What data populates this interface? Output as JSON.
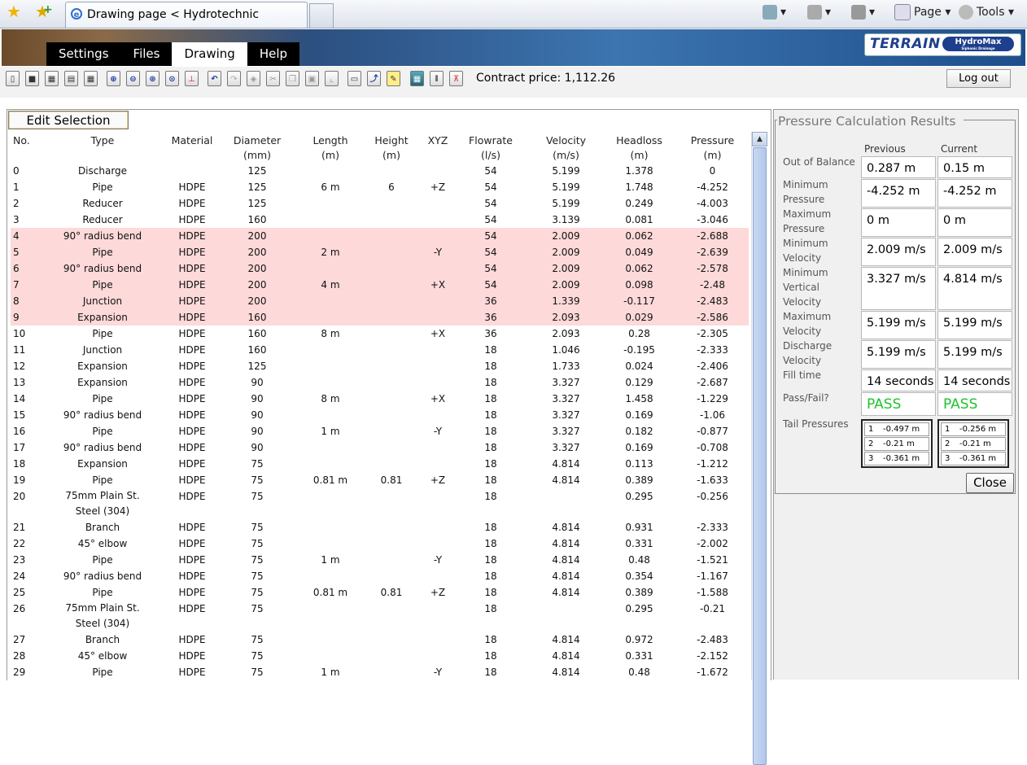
{
  "browser": {
    "tab_title": "Drawing page < Hydrotechnic",
    "page_label": "Page ▾",
    "tools_label": "Tools ▾"
  },
  "app": {
    "menu": [
      "Settings",
      "Files",
      "Drawing",
      "Help"
    ],
    "active_menu": "Drawing",
    "logo_text": "TERRAIN",
    "logo_product": "HydroMax",
    "logo_tagline": "Siphonic Drainage",
    "contract_price": "Contract price: 1,112.26",
    "logout_label": "Log out",
    "edit_selection_label": "Edit Selection"
  },
  "table": {
    "headers": {
      "no": "No.",
      "type": "Type",
      "material": "Material",
      "diameter": "Diameter\n(mm)",
      "length": "Length\n(m)",
      "height": "Height\n(m)",
      "xyz": "XYZ",
      "flowrate": "Flowrate\n(l/s)",
      "velocity": "Velocity\n(m/s)",
      "headloss": "Headloss\n(m)",
      "pressure": "Pressure\n(m)"
    },
    "rows": [
      {
        "no": "0",
        "type": "Discharge",
        "material": "",
        "diameter": "125",
        "length": "",
        "height": "",
        "xyz": "",
        "flowrate": "54",
        "velocity": "5.199",
        "headloss": "1.378",
        "pressure": "0",
        "hl": false
      },
      {
        "no": "1",
        "type": "Pipe",
        "material": "HDPE",
        "diameter": "125",
        "length": "6 m",
        "height": "6",
        "xyz": "+Z",
        "flowrate": "54",
        "velocity": "5.199",
        "headloss": "1.748",
        "pressure": "-4.252",
        "hl": false
      },
      {
        "no": "2",
        "type": "Reducer",
        "material": "HDPE",
        "diameter": "125",
        "length": "",
        "height": "",
        "xyz": "",
        "flowrate": "54",
        "velocity": "5.199",
        "headloss": "0.249",
        "pressure": "-4.003",
        "hl": false
      },
      {
        "no": "3",
        "type": "Reducer",
        "material": "HDPE",
        "diameter": "160",
        "length": "",
        "height": "",
        "xyz": "",
        "flowrate": "54",
        "velocity": "3.139",
        "headloss": "0.081",
        "pressure": "-3.046",
        "hl": false
      },
      {
        "no": "4",
        "type": "90° radius bend",
        "material": "HDPE",
        "diameter": "200",
        "length": "",
        "height": "",
        "xyz": "",
        "flowrate": "54",
        "velocity": "2.009",
        "headloss": "0.062",
        "pressure": "-2.688",
        "hl": true
      },
      {
        "no": "5",
        "type": "Pipe",
        "material": "HDPE",
        "diameter": "200",
        "length": "2 m",
        "height": "",
        "xyz": "-Y",
        "flowrate": "54",
        "velocity": "2.009",
        "headloss": "0.049",
        "pressure": "-2.639",
        "hl": true
      },
      {
        "no": "6",
        "type": "90° radius bend",
        "material": "HDPE",
        "diameter": "200",
        "length": "",
        "height": "",
        "xyz": "",
        "flowrate": "54",
        "velocity": "2.009",
        "headloss": "0.062",
        "pressure": "-2.578",
        "hl": true
      },
      {
        "no": "7",
        "type": "Pipe",
        "material": "HDPE",
        "diameter": "200",
        "length": "4 m",
        "height": "",
        "xyz": "+X",
        "flowrate": "54",
        "velocity": "2.009",
        "headloss": "0.098",
        "pressure": "-2.48",
        "hl": true
      },
      {
        "no": "8",
        "type": "Junction",
        "material": "HDPE",
        "diameter": "200",
        "length": "",
        "height": "",
        "xyz": "",
        "flowrate": "36",
        "velocity": "1.339",
        "headloss": "-0.117",
        "pressure": "-2.483",
        "hl": true
      },
      {
        "no": "9",
        "type": "Expansion",
        "material": "HDPE",
        "diameter": "160",
        "length": "",
        "height": "",
        "xyz": "",
        "flowrate": "36",
        "velocity": "2.093",
        "headloss": "0.029",
        "pressure": "-2.586",
        "hl": true
      },
      {
        "no": "10",
        "type": "Pipe",
        "material": "HDPE",
        "diameter": "160",
        "length": "8 m",
        "height": "",
        "xyz": "+X",
        "flowrate": "36",
        "velocity": "2.093",
        "headloss": "0.28",
        "pressure": "-2.305",
        "hl": false
      },
      {
        "no": "11",
        "type": "Junction",
        "material": "HDPE",
        "diameter": "160",
        "length": "",
        "height": "",
        "xyz": "",
        "flowrate": "18",
        "velocity": "1.046",
        "headloss": "-0.195",
        "pressure": "-2.333",
        "hl": false
      },
      {
        "no": "12",
        "type": "Expansion",
        "material": "HDPE",
        "diameter": "125",
        "length": "",
        "height": "",
        "xyz": "",
        "flowrate": "18",
        "velocity": "1.733",
        "headloss": "0.024",
        "pressure": "-2.406",
        "hl": false
      },
      {
        "no": "13",
        "type": "Expansion",
        "material": "HDPE",
        "diameter": "90",
        "length": "",
        "height": "",
        "xyz": "",
        "flowrate": "18",
        "velocity": "3.327",
        "headloss": "0.129",
        "pressure": "-2.687",
        "hl": false
      },
      {
        "no": "14",
        "type": "Pipe",
        "material": "HDPE",
        "diameter": "90",
        "length": "8 m",
        "height": "",
        "xyz": "+X",
        "flowrate": "18",
        "velocity": "3.327",
        "headloss": "1.458",
        "pressure": "-1.229",
        "hl": false
      },
      {
        "no": "15",
        "type": "90° radius bend",
        "material": "HDPE",
        "diameter": "90",
        "length": "",
        "height": "",
        "xyz": "",
        "flowrate": "18",
        "velocity": "3.327",
        "headloss": "0.169",
        "pressure": "-1.06",
        "hl": false
      },
      {
        "no": "16",
        "type": "Pipe",
        "material": "HDPE",
        "diameter": "90",
        "length": "1 m",
        "height": "",
        "xyz": "-Y",
        "flowrate": "18",
        "velocity": "3.327",
        "headloss": "0.182",
        "pressure": "-0.877",
        "hl": false
      },
      {
        "no": "17",
        "type": "90° radius bend",
        "material": "HDPE",
        "diameter": "90",
        "length": "",
        "height": "",
        "xyz": "",
        "flowrate": "18",
        "velocity": "3.327",
        "headloss": "0.169",
        "pressure": "-0.708",
        "hl": false
      },
      {
        "no": "18",
        "type": "Expansion",
        "material": "HDPE",
        "diameter": "75",
        "length": "",
        "height": "",
        "xyz": "",
        "flowrate": "18",
        "velocity": "4.814",
        "headloss": "0.113",
        "pressure": "-1.212",
        "hl": false
      },
      {
        "no": "19",
        "type": "Pipe",
        "material": "HDPE",
        "diameter": "75",
        "length": "0.81 m",
        "height": "0.81",
        "xyz": "+Z",
        "flowrate": "18",
        "velocity": "4.814",
        "headloss": "0.389",
        "pressure": "-1.633",
        "hl": false
      },
      {
        "no": "20",
        "type": "75mm Plain St. Steel (304)",
        "material": "HDPE",
        "diameter": "75",
        "length": "",
        "height": "",
        "xyz": "",
        "flowrate": "18",
        "velocity": "",
        "headloss": "0.295",
        "pressure": "-0.256",
        "hl": false,
        "tall": true
      },
      {
        "no": "21",
        "type": "Branch",
        "material": "HDPE",
        "diameter": "75",
        "length": "",
        "height": "",
        "xyz": "",
        "flowrate": "18",
        "velocity": "4.814",
        "headloss": "0.931",
        "pressure": "-2.333",
        "hl": false
      },
      {
        "no": "22",
        "type": "45° elbow",
        "material": "HDPE",
        "diameter": "75",
        "length": "",
        "height": "",
        "xyz": "",
        "flowrate": "18",
        "velocity": "4.814",
        "headloss": "0.331",
        "pressure": "-2.002",
        "hl": false
      },
      {
        "no": "23",
        "type": "Pipe",
        "material": "HDPE",
        "diameter": "75",
        "length": "1 m",
        "height": "",
        "xyz": "-Y",
        "flowrate": "18",
        "velocity": "4.814",
        "headloss": "0.48",
        "pressure": "-1.521",
        "hl": false
      },
      {
        "no": "24",
        "type": "90° radius bend",
        "material": "HDPE",
        "diameter": "75",
        "length": "",
        "height": "",
        "xyz": "",
        "flowrate": "18",
        "velocity": "4.814",
        "headloss": "0.354",
        "pressure": "-1.167",
        "hl": false
      },
      {
        "no": "25",
        "type": "Pipe",
        "material": "HDPE",
        "diameter": "75",
        "length": "0.81 m",
        "height": "0.81",
        "xyz": "+Z",
        "flowrate": "18",
        "velocity": "4.814",
        "headloss": "0.389",
        "pressure": "-1.588",
        "hl": false
      },
      {
        "no": "26",
        "type": "75mm Plain St. Steel (304)",
        "material": "HDPE",
        "diameter": "75",
        "length": "",
        "height": "",
        "xyz": "",
        "flowrate": "18",
        "velocity": "",
        "headloss": "0.295",
        "pressure": "-0.21",
        "hl": false,
        "tall": true
      },
      {
        "no": "27",
        "type": "Branch",
        "material": "HDPE",
        "diameter": "75",
        "length": "",
        "height": "",
        "xyz": "",
        "flowrate": "18",
        "velocity": "4.814",
        "headloss": "0.972",
        "pressure": "-2.483",
        "hl": false
      },
      {
        "no": "28",
        "type": "45° elbow",
        "material": "HDPE",
        "diameter": "75",
        "length": "",
        "height": "",
        "xyz": "",
        "flowrate": "18",
        "velocity": "4.814",
        "headloss": "0.331",
        "pressure": "-2.152",
        "hl": false
      },
      {
        "no": "29",
        "type": "Pipe",
        "material": "HDPE",
        "diameter": "75",
        "length": "1 m",
        "height": "",
        "xyz": "-Y",
        "flowrate": "18",
        "velocity": "4.814",
        "headloss": "0.48",
        "pressure": "-1.672",
        "hl": false
      }
    ]
  },
  "results": {
    "title": "Pressure Calculation Results",
    "col_previous": "Previous",
    "col_current": "Current",
    "rows": [
      {
        "label": "Out of Balance",
        "previous": "0.287 m",
        "current": "0.15 m"
      },
      {
        "label": "Minimum Pressure",
        "previous": "-4.252 m",
        "current": "-4.252 m"
      },
      {
        "label": "Maximum Pressure",
        "previous": "0 m",
        "current": "0 m"
      },
      {
        "label": "Minimum Velocity",
        "previous": "2.009 m/s",
        "current": "2.009 m/s"
      },
      {
        "label": "Minimum Vertical Velocity",
        "previous": "3.327 m/s",
        "current": "4.814 m/s"
      },
      {
        "label": "Maximum Velocity",
        "previous": "5.199 m/s",
        "current": "5.199 m/s"
      },
      {
        "label": "Discharge Velocity",
        "previous": "5.199 m/s",
        "current": "5.199 m/s"
      },
      {
        "label": "Fill time",
        "previous": "14 seconds",
        "current": "14 seconds"
      },
      {
        "label": "Pass/Fail?",
        "previous": "PASS",
        "current": "PASS"
      }
    ],
    "tail_label": "Tail Pressures",
    "tail_previous": [
      {
        "n": "1",
        "v": "-0.497 m"
      },
      {
        "n": "2",
        "v": "-0.21 m"
      },
      {
        "n": "3",
        "v": "-0.361 m"
      }
    ],
    "tail_current": [
      {
        "n": "1",
        "v": "-0.256 m"
      },
      {
        "n": "2",
        "v": "-0.21 m"
      },
      {
        "n": "3",
        "v": "-0.361 m"
      }
    ],
    "close_label": "Close",
    "pass_color": "#22c22e",
    "highlight_color": "#fdd9d9"
  }
}
